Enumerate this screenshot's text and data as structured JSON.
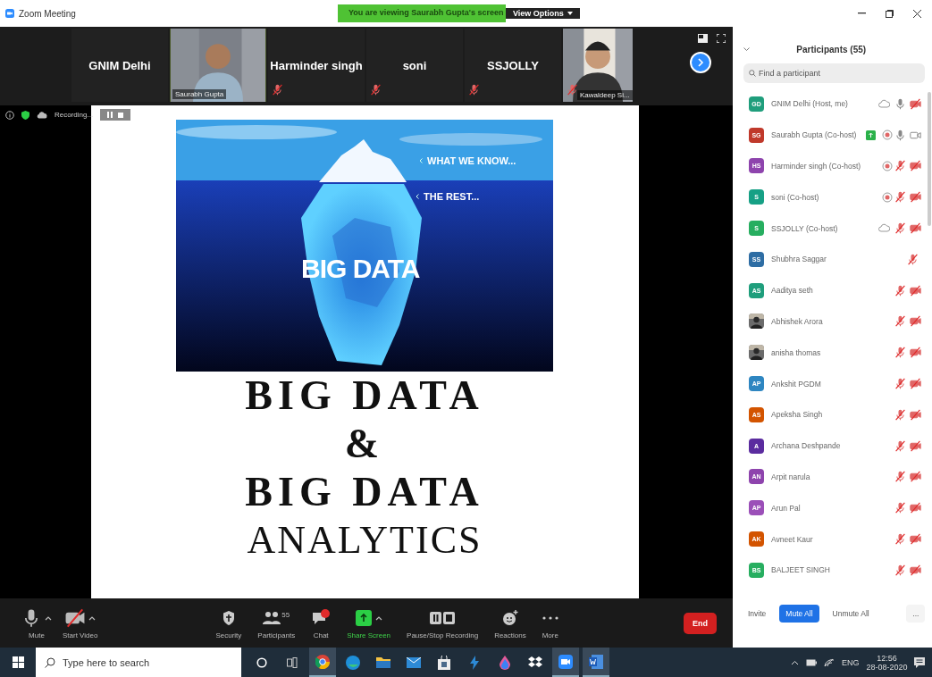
{
  "window": {
    "title": "Zoom Meeting"
  },
  "banner": {
    "text": "You are viewing Saurabh Gupta's screen",
    "view_options": "View Options"
  },
  "gallery": [
    {
      "kind": "name",
      "name": "GNIM Delhi",
      "muted": false
    },
    {
      "kind": "video",
      "name": "Saurabh Gupta",
      "muted": false
    },
    {
      "kind": "name",
      "name": "Harminder singh",
      "muted": true
    },
    {
      "kind": "name",
      "name": "soni",
      "muted": true
    },
    {
      "kind": "name",
      "name": "SSJOLLY",
      "muted": true
    },
    {
      "kind": "video",
      "name": "Kawaldeep Si...",
      "muted": true
    }
  ],
  "recording": {
    "label": "Recording..."
  },
  "slide": {
    "image_items": [
      "WHAT WE KNOW...",
      "THE REST..."
    ],
    "image_title": "BIG DATA",
    "lines": [
      "BIG DATA",
      "&",
      "BIG DATA",
      "ANALYTICS"
    ]
  },
  "toolbar": [
    {
      "kind": "mic",
      "label": "Mute",
      "menu": true
    },
    {
      "kind": "video",
      "label": "Start Video",
      "menu": true
    },
    {
      "kind": "security",
      "label": "Security",
      "menu": false
    },
    {
      "kind": "participants",
      "label": "Participants",
      "count": "55",
      "menu": false
    },
    {
      "kind": "chat",
      "label": "Chat",
      "menu": false
    },
    {
      "kind": "share",
      "label": "Share Screen",
      "menu": true
    },
    {
      "kind": "record",
      "label": "Pause/Stop Recording",
      "menu": false
    },
    {
      "kind": "reactions",
      "label": "Reactions",
      "menu": false
    },
    {
      "kind": "more",
      "label": "More",
      "menu": false
    }
  ],
  "end_button": "End",
  "participants": {
    "title": "Participants (55)",
    "search": {
      "placeholder": "Find a participant"
    },
    "list": [
      {
        "kind": "initials",
        "initials": "GD",
        "color": "#1f9e7c",
        "name": "GNIM Delhi (Host, me)",
        "cloud": true,
        "recording": false,
        "sharing": false,
        "muted": false,
        "camera": true,
        "video_off": true
      },
      {
        "kind": "initials",
        "initials": "SG",
        "color": "#c0392b",
        "name": "Saurabh Gupta (Co-host)",
        "cloud": false,
        "recording": true,
        "sharing": true,
        "muted": false,
        "camera": true,
        "video_off": false
      },
      {
        "kind": "initials",
        "initials": "HS",
        "color": "#8e44ad",
        "name": "Harminder singh (Co-host)",
        "cloud": false,
        "recording": true,
        "sharing": false,
        "muted": true,
        "camera": true,
        "video_off": true
      },
      {
        "kind": "initials",
        "initials": "S",
        "color": "#16a085",
        "name": "soni (Co-host)",
        "cloud": false,
        "recording": true,
        "sharing": false,
        "muted": true,
        "camera": true,
        "video_off": true
      },
      {
        "kind": "initials",
        "initials": "S",
        "color": "#27ae60",
        "name": "SSJOLLY (Co-host)",
        "cloud": true,
        "recording": false,
        "sharing": false,
        "muted": true,
        "camera": true,
        "video_off": true
      },
      {
        "kind": "initials",
        "initials": "SS",
        "color": "#2e6da4",
        "name": "Shubhra Saggar",
        "cloud": false,
        "recording": false,
        "sharing": false,
        "muted": true,
        "camera": false
      },
      {
        "kind": "initials",
        "initials": "AS",
        "color": "#1f9e7c",
        "name": "Aaditya seth",
        "cloud": false,
        "recording": false,
        "sharing": false,
        "muted": true,
        "camera": true,
        "video_off": true
      },
      {
        "name": "Abhishek Arora",
        "cloud": false,
        "recording": false,
        "sharing": false,
        "muted": true,
        "camera": true,
        "video_off": true
      },
      {
        "name": "anisha thomas",
        "cloud": false,
        "recording": false,
        "sharing": false,
        "muted": true,
        "camera": true,
        "video_off": true
      },
      {
        "kind": "initials",
        "initials": "AP",
        "color": "#2e86c1",
        "name": "Ankshit PGDM",
        "cloud": false,
        "recording": false,
        "sharing": false,
        "muted": true,
        "camera": true,
        "video_off": true
      },
      {
        "kind": "initials",
        "initials": "AS",
        "color": "#d35400",
        "name": "Apeksha Singh",
        "cloud": false,
        "recording": false,
        "sharing": false,
        "muted": true,
        "camera": true,
        "video_off": true
      },
      {
        "kind": "initials",
        "initials": "A",
        "color": "#5b2c9f",
        "name": "Archana Deshpande",
        "cloud": false,
        "recording": false,
        "sharing": false,
        "muted": true,
        "camera": true,
        "video_off": true
      },
      {
        "kind": "initials",
        "initials": "AN",
        "color": "#8e44ad",
        "name": "Arpit narula",
        "cloud": false,
        "recording": false,
        "sharing": false,
        "muted": true,
        "camera": true,
        "video_off": true
      },
      {
        "kind": "initials",
        "initials": "AP",
        "color": "#9b4fb8",
        "name": "Arun Pal",
        "cloud": false,
        "recording": false,
        "sharing": false,
        "muted": true,
        "camera": true,
        "video_off": true
      },
      {
        "kind": "initials",
        "initials": "AK",
        "color": "#d35400",
        "name": "Avneet Kaur",
        "cloud": false,
        "recording": false,
        "sharing": false,
        "muted": true,
        "camera": true,
        "video_off": true
      },
      {
        "kind": "initials",
        "initials": "BS",
        "color": "#27ae60",
        "name": "BALJEET SINGH",
        "cloud": false,
        "recording": false,
        "sharing": false,
        "muted": true,
        "camera": true,
        "video_off": true
      }
    ],
    "buttons": [
      {
        "kind": "plain",
        "label": "Invite"
      },
      {
        "kind": "primary",
        "label": "Mute All"
      },
      {
        "kind": "plain",
        "label": "Unmute All"
      },
      {
        "kind": "more",
        "label": "..."
      }
    ]
  },
  "taskbar": {
    "search": {
      "placeholder": "Type here to search"
    },
    "language": "ENG",
    "time": "12:56",
    "date": "28-08-2020"
  }
}
